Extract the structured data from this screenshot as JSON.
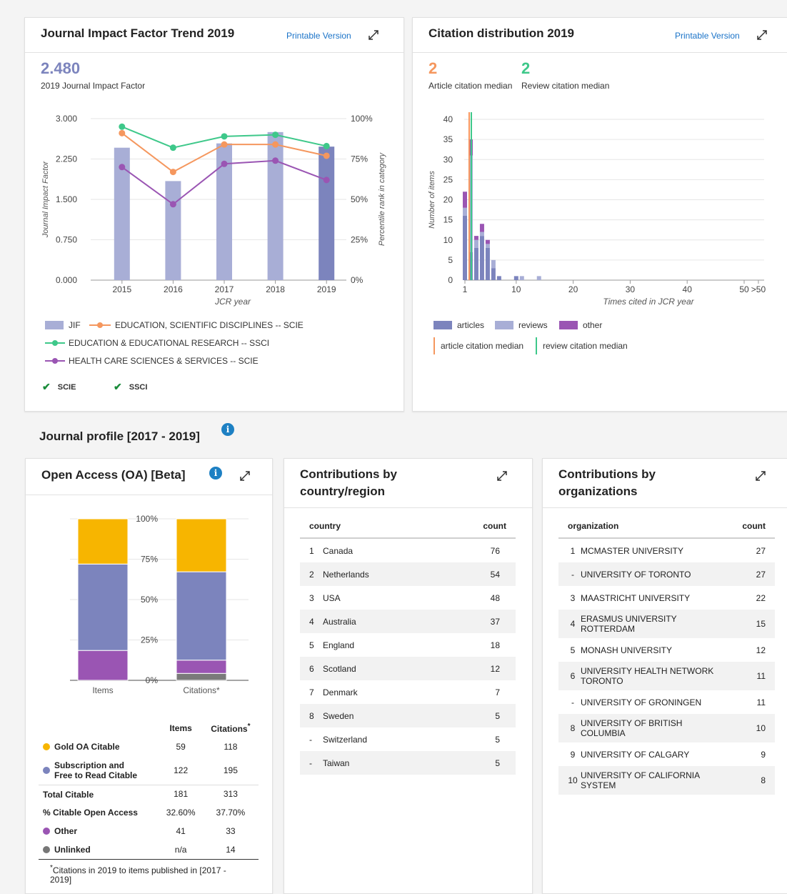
{
  "jif_card": {
    "title": "Journal Impact Factor Trend 2019",
    "printable": "Printable Version",
    "jif_value": "2.480",
    "jif_caption": "2019 Journal Impact Factor",
    "legend": {
      "jif": "JIF",
      "edu_sci": "EDUCATION, SCIENTIFIC DISCIPLINES -- SCIE",
      "edu_res": "EDUCATION & EDUCATIONAL RESEARCH -- SSCI",
      "health": "HEALTH CARE SCIENCES & SERVICES -- SCIE"
    },
    "filters": [
      "SCIE",
      "SSCI"
    ],
    "colors": {
      "bar": "#a8aed6",
      "bar_current": "#7c84bd",
      "edu_sci": "#f5975e",
      "edu_res": "#3ec88a",
      "health": "#9a55b3"
    }
  },
  "citation_card": {
    "title": "Citation distribution 2019",
    "printable": "Printable Version",
    "article_median": "2",
    "article_median_label": "Article citation median",
    "review_median": "2",
    "review_median_label": "Review citation median",
    "legend": {
      "articles": "articles",
      "reviews": "reviews",
      "other": "other",
      "article_median": "article citation median",
      "review_median": "review citation median"
    },
    "colors": {
      "articles": "#7c84bd",
      "reviews": "#a8aed6",
      "other": "#9a55b3",
      "article_median": "#f5975e",
      "review_median": "#3ec88a"
    }
  },
  "chart_data": [
    {
      "type": "bar",
      "xlabel": "JCR year",
      "ylabel": "Journal Impact Factor",
      "y2label": "Percentile rank in category",
      "categories": [
        "2015",
        "2016",
        "2017",
        "2018",
        "2019"
      ],
      "ylim": [
        0,
        3.0
      ],
      "y2lim": [
        0,
        100
      ],
      "yticks": [
        "0.000",
        "0.750",
        "1.500",
        "2.250",
        "3.000"
      ],
      "y2ticks": [
        "0%",
        "25%",
        "50%",
        "75%",
        "100%"
      ],
      "series": [
        {
          "name": "JIF",
          "type": "bar",
          "values": [
            2.46,
            1.84,
            2.54,
            2.75,
            2.48
          ]
        },
        {
          "name": "EDUCATION, SCIENTIFIC DISCIPLINES -- SCIE",
          "type": "line",
          "axis": "right",
          "values": [
            91,
            67,
            84,
            84,
            77
          ]
        },
        {
          "name": "EDUCATION & EDUCATIONAL RESEARCH -- SSCI",
          "type": "line",
          "axis": "right",
          "values": [
            95,
            82,
            89,
            90,
            83
          ]
        },
        {
          "name": "HEALTH CARE SCIENCES & SERVICES -- SCIE",
          "type": "line",
          "axis": "right",
          "values": [
            70,
            47,
            72,
            74,
            62
          ]
        }
      ]
    },
    {
      "type": "bar",
      "stacked": true,
      "xlabel": "Times cited in JCR year",
      "ylabel": "Number of items",
      "ylim": [
        0,
        40
      ],
      "yticks": [
        0,
        5,
        10,
        15,
        20,
        25,
        30,
        35,
        40
      ],
      "xticks": [
        "1",
        "10",
        "20",
        "30",
        "40",
        "50",
        ">50"
      ],
      "x": [
        1,
        2,
        3,
        4,
        5,
        6,
        7,
        10,
        11,
        14
      ],
      "series": [
        {
          "name": "articles",
          "values": [
            16,
            7,
            8,
            11,
            8,
            3,
            1,
            1,
            0,
            0
          ]
        },
        {
          "name": "reviews",
          "values": [
            2,
            24,
            2,
            1,
            1,
            2,
            0,
            0,
            1,
            1
          ]
        },
        {
          "name": "other",
          "values": [
            4,
            4,
            1,
            2,
            1,
            0,
            0,
            0,
            0,
            0
          ]
        }
      ],
      "article_median": 2,
      "review_median": 2
    },
    {
      "type": "bar",
      "stacked": true,
      "categories": [
        "Items",
        "Citations*"
      ],
      "yticks": [
        "0%",
        "25%",
        "50%",
        "75%",
        "100%"
      ],
      "ylim": [
        0,
        100
      ],
      "series": [
        {
          "name": "Unlinked",
          "values": [
            0,
            4.3
          ]
        },
        {
          "name": "Other",
          "values": [
            18.5,
            8.2
          ]
        },
        {
          "name": "Subscription and Free to Read Citable",
          "values": [
            53.5,
            54.7
          ]
        },
        {
          "name": "Gold OA Citable",
          "values": [
            28.0,
            32.8
          ]
        }
      ]
    }
  ],
  "profile": {
    "title": "Journal profile [2017 - 2019]"
  },
  "oa_card": {
    "title": "Open Access (OA) [Beta]",
    "col_items": "Items",
    "col_citations": "Citations",
    "rows": [
      {
        "label": "Gold OA Citable",
        "dot": "#f7b500",
        "items": "59",
        "citations": "118"
      },
      {
        "label": "Subscription and\nFree to Read Citable",
        "dot": "#7c84bd",
        "items": "122",
        "citations": "195"
      },
      {
        "label": "Total Citable",
        "dot": "",
        "items": "181",
        "citations": "313"
      },
      {
        "label": "% Citable Open Access",
        "dot": "",
        "items": "32.60%",
        "citations": "37.70%"
      },
      {
        "label": "Other",
        "dot": "#9a55b3",
        "items": "41",
        "citations": "33"
      },
      {
        "label": "Unlinked",
        "dot": "#777777",
        "items": "n/a",
        "citations": "14"
      }
    ],
    "footnote": "Citations in 2019 to items published in [2017 - 2019]",
    "colors": {
      "gold": "#f7b500",
      "subscription": "#7c84bd",
      "other": "#9a55b3",
      "unlinked": "#7a7a7a"
    }
  },
  "country_card": {
    "title_line1": "Contributions by",
    "title_line2": "country/region",
    "col_name": "country",
    "col_count": "count",
    "rows": [
      {
        "rank": "1",
        "name": "Canada",
        "count": "76"
      },
      {
        "rank": "2",
        "name": "Netherlands",
        "count": "54"
      },
      {
        "rank": "3",
        "name": "USA",
        "count": "48"
      },
      {
        "rank": "4",
        "name": "Australia",
        "count": "37"
      },
      {
        "rank": "5",
        "name": "England",
        "count": "18"
      },
      {
        "rank": "6",
        "name": "Scotland",
        "count": "12"
      },
      {
        "rank": "7",
        "name": "Denmark",
        "count": "7"
      },
      {
        "rank": "8",
        "name": "Sweden",
        "count": "5"
      },
      {
        "rank": "-",
        "name": "Switzerland",
        "count": "5"
      },
      {
        "rank": "-",
        "name": "Taiwan",
        "count": "5"
      }
    ]
  },
  "org_card": {
    "title_line1": "Contributions by",
    "title_line2": "organizations",
    "col_name": "organization",
    "col_count": "count",
    "rows": [
      {
        "rank": "1",
        "name": "MCMASTER UNIVERSITY",
        "count": "27"
      },
      {
        "rank": "-",
        "name": "UNIVERSITY OF TORONTO",
        "count": "27"
      },
      {
        "rank": "3",
        "name": "MAASTRICHT UNIVERSITY",
        "count": "22"
      },
      {
        "rank": "4",
        "name": "ERASMUS UNIVERSITY\nROTTERDAM",
        "count": "15"
      },
      {
        "rank": "5",
        "name": "MONASH UNIVERSITY",
        "count": "12"
      },
      {
        "rank": "6",
        "name": "UNIVERSITY HEALTH NETWORK\nTORONTO",
        "count": "11"
      },
      {
        "rank": "-",
        "name": "UNIVERSITY OF GRONINGEN",
        "count": "11"
      },
      {
        "rank": "8",
        "name": "UNIVERSITY OF BRITISH\nCOLUMBIA",
        "count": "10"
      },
      {
        "rank": "9",
        "name": "UNIVERSITY OF CALGARY",
        "count": "9"
      },
      {
        "rank": "10",
        "name": "UNIVERSITY OF CALIFORNIA\nSYSTEM",
        "count": "8"
      }
    ]
  }
}
